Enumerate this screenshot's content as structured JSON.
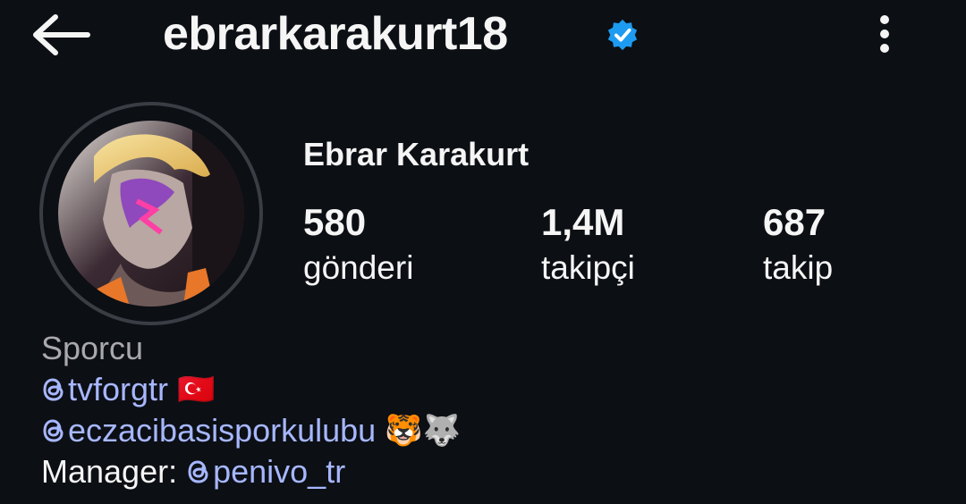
{
  "header": {
    "username": "ebrarkarakurt18",
    "back_icon": "arrow-left-icon",
    "verified_icon": "verified-badge-icon",
    "more_icon": "more-vertical-icon"
  },
  "profile": {
    "full_name": "Ebrar Karakurt",
    "avatar_icon": "profile-photo"
  },
  "stats": [
    {
      "value": "580",
      "label": "gönderi"
    },
    {
      "value": "1,4M",
      "label": "takipçi"
    },
    {
      "value": "687",
      "label": "takip"
    }
  ],
  "bio": {
    "category": "Sporcu",
    "links": [
      {
        "handle": "tvforgtr",
        "emoji": "🇹🇷"
      },
      {
        "handle": "eczacibasisporkulubu",
        "emoji": "🐯🐺"
      }
    ],
    "manager_label": "Manager:",
    "manager_handle": "penivo_tr"
  },
  "colors": {
    "background": "#0c0f14",
    "link": "#a7b7ff",
    "category": "#a8a8ad",
    "verified": "#1d9bf0"
  }
}
